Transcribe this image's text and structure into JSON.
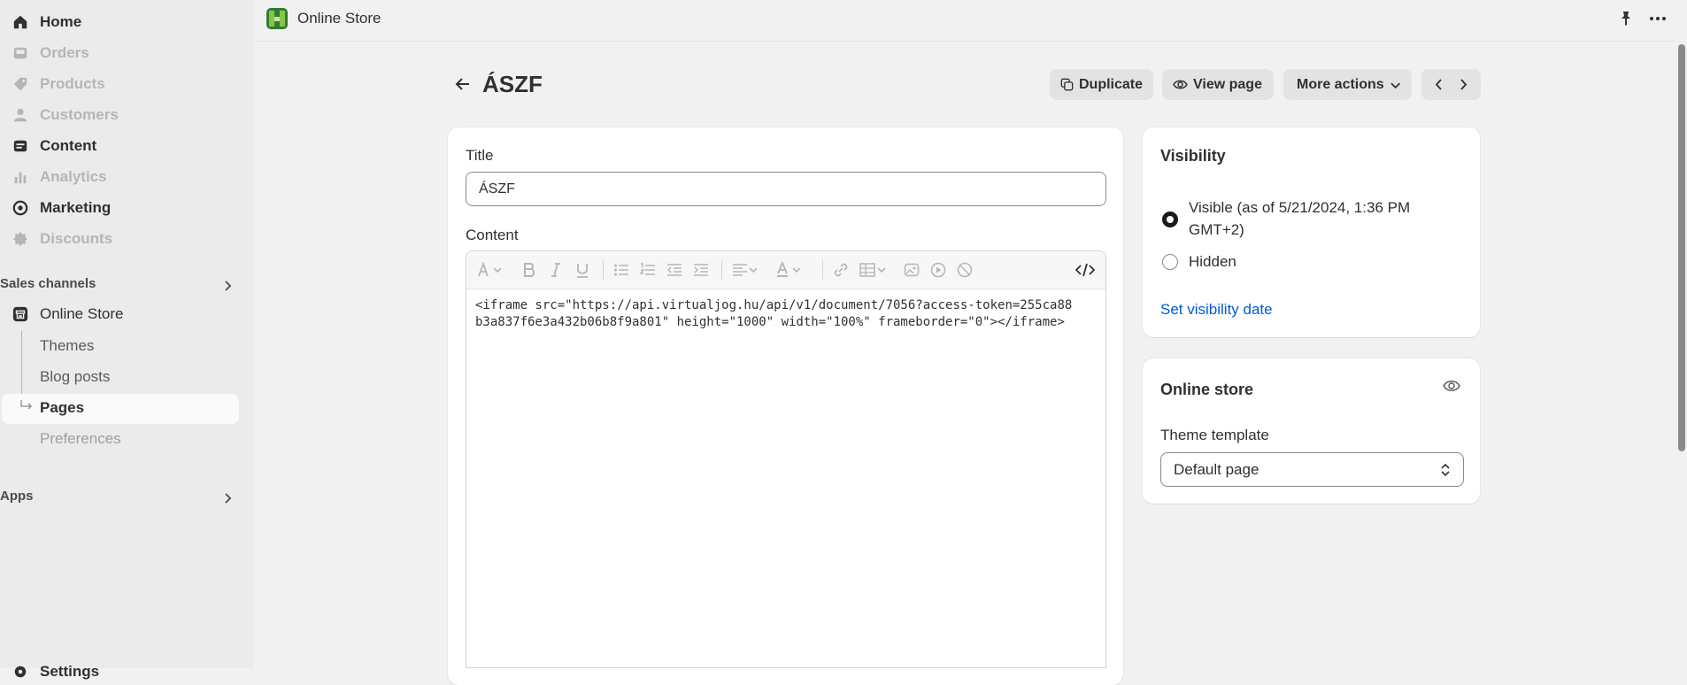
{
  "topbar": {
    "store_name": "Online Store"
  },
  "sidebar": {
    "items": [
      {
        "label": "Home",
        "icon": "home-icon"
      },
      {
        "label": "Orders",
        "icon": "inbox-icon"
      },
      {
        "label": "Products",
        "icon": "tag-icon"
      },
      {
        "label": "Customers",
        "icon": "person-icon"
      },
      {
        "label": "Content",
        "icon": "content-icon"
      },
      {
        "label": "Analytics",
        "icon": "bar-chart-icon"
      },
      {
        "label": "Marketing",
        "icon": "target-icon"
      },
      {
        "label": "Discounts",
        "icon": "discount-icon"
      }
    ],
    "sales_channels_title": "Sales channels",
    "online_store": "Online Store",
    "sub_items": [
      "Themes",
      "Blog posts",
      "Pages",
      "Preferences"
    ],
    "apps_title": "Apps",
    "settings_label": "Settings"
  },
  "page": {
    "title": "ÁSZF",
    "actions": {
      "duplicate": "Duplicate",
      "view_page": "View page",
      "more_actions": "More actions"
    }
  },
  "form": {
    "title_label": "Title",
    "title_value": "ÁSZF",
    "content_label": "Content",
    "content_value": "<iframe src=\"https://api.virtualjog.hu/api/v1/document/7056?access-token=255ca88b3a837f6e3a432b06b8f9a801\" height=\"1000\" width=\"100%\" frameborder=\"0\"></iframe>"
  },
  "visibility": {
    "title": "Visibility",
    "visible_label": "Visible (as of 5/21/2024, 1:36 PM GMT+2)",
    "hidden_label": "Hidden",
    "set_date_link": "Set visibility date"
  },
  "online_store_card": {
    "title": "Online store",
    "template_label": "Theme template",
    "template_value": "Default page"
  }
}
